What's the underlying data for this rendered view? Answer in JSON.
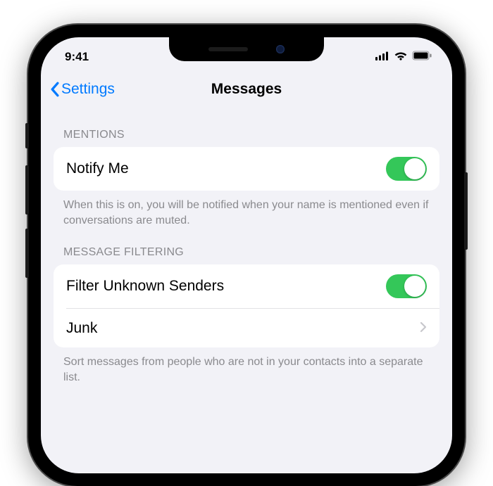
{
  "status": {
    "time": "9:41"
  },
  "nav": {
    "back": "Settings",
    "title": "Messages"
  },
  "mentions": {
    "header": "Mentions",
    "notify_label": "Notify Me",
    "notify_on": true,
    "footer": "When this is on, you will be notified when your name is mentioned even if conversations are muted."
  },
  "filtering": {
    "header": "Message Filtering",
    "filter_unknown_label": "Filter Unknown Senders",
    "filter_unknown_on": true,
    "junk_label": "Junk",
    "footer": "Sort messages from people who are not in your contacts into a separate list."
  },
  "colors": {
    "tint": "#007aff",
    "toggle_on": "#34c759",
    "bg": "#f2f2f7"
  }
}
